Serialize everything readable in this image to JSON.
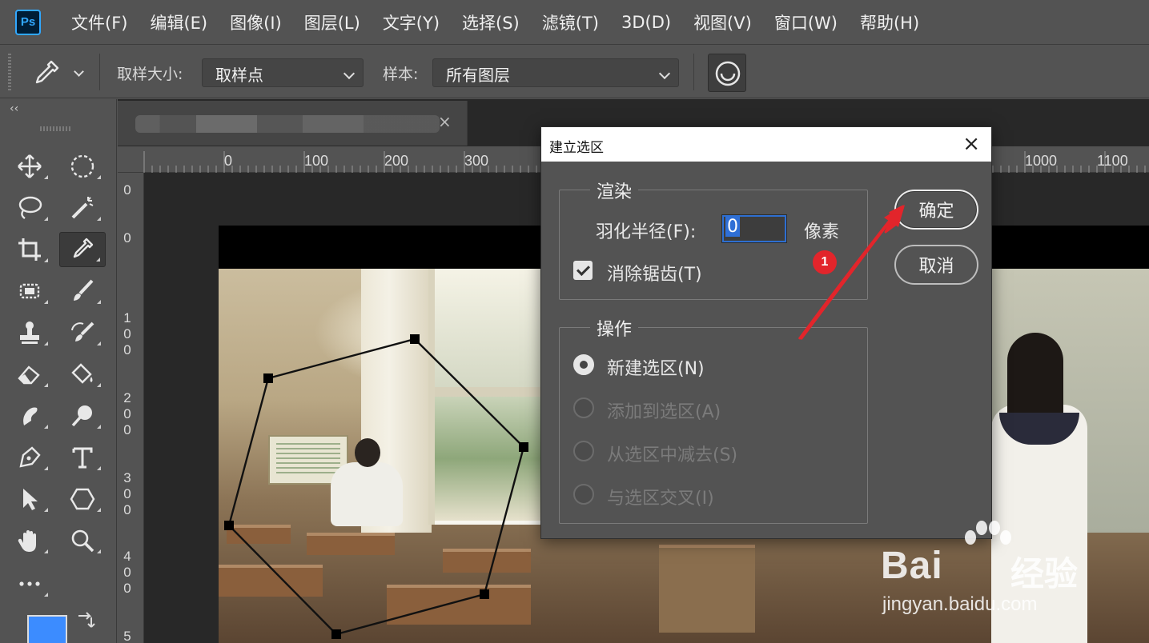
{
  "app": {
    "logo": "Ps"
  },
  "menu": [
    "文件(F)",
    "编辑(E)",
    "图像(I)",
    "图层(L)",
    "文字(Y)",
    "选择(S)",
    "滤镜(T)",
    "3D(D)",
    "视图(V)",
    "窗口(W)",
    "帮助(H)"
  ],
  "options": {
    "tool_icon": "eyedropper-icon",
    "sample_size_label": "取样大小:",
    "sample_size_value": "取样点",
    "sample_label": "样本:",
    "sample_value": "所有图层"
  },
  "panel": {
    "collapse": "‹‹"
  },
  "tools": [
    "move-icon",
    "ellipse-marquee-icon",
    "lasso-icon",
    "magic-wand-icon",
    "crop-icon",
    "eyedropper-icon",
    "healing-brush-icon",
    "brush-icon",
    "stamp-icon",
    "history-brush-icon",
    "eraser-icon",
    "paint-bucket-icon",
    "smudge-icon",
    "dodge-icon",
    "pen-icon",
    "type-icon",
    "path-select-icon",
    "shape-icon",
    "hand-icon",
    "zoom-icon",
    "more-icon"
  ],
  "document": {
    "tab_close": "×"
  },
  "ruler_top": [
    "0",
    "100",
    "200",
    "300",
    "1000",
    "1100"
  ],
  "ruler_left": [
    "0",
    "0",
    "100",
    "200",
    "300",
    "400",
    "5"
  ],
  "dialog": {
    "title": "建立选区",
    "close": "×",
    "render_group": "渲染",
    "feather_label": "羽化半径(F):",
    "feather_value": "0",
    "feather_unit": "像素",
    "antialias_label": "消除锯齿(T)",
    "antialias_checked": true,
    "operation_group": "操作",
    "operations": [
      {
        "label": "新建选区(N)",
        "selected": true,
        "enabled": true
      },
      {
        "label": "添加到选区(A)",
        "selected": false,
        "enabled": false
      },
      {
        "label": "从选区中减去(S)",
        "selected": false,
        "enabled": false
      },
      {
        "label": "与选区交叉(I)",
        "selected": false,
        "enabled": false
      }
    ],
    "ok": "确定",
    "cancel": "取消"
  },
  "annotation": {
    "badge": "1",
    "color": "#e2252b"
  },
  "watermark": {
    "brand": "Bai",
    "cn": "经验",
    "url": "jingyan.baidu.com"
  },
  "colors": {
    "foreground": "#3c8cff",
    "accent": "#31a8ff"
  }
}
